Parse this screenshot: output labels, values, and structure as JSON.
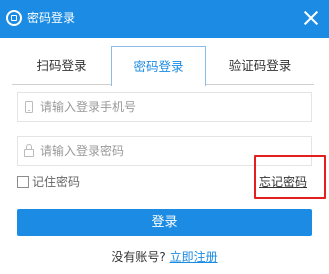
{
  "window": {
    "title": "密码登录",
    "close_icon": "close-icon",
    "app_icon": "app-logo-icon",
    "accent_color": "#1b8be3"
  },
  "tabs": [
    {
      "label": "扫码登录",
      "active": false
    },
    {
      "label": "密码登录",
      "active": true
    },
    {
      "label": "验证码登录",
      "active": false
    }
  ],
  "form": {
    "phone": {
      "placeholder": "请输入登录手机号",
      "value": "",
      "icon": "phone-icon"
    },
    "password": {
      "placeholder": "请输入登录密码",
      "value": "",
      "icon": "lock-icon"
    },
    "remember_label": "记住密码",
    "remember_checked": false,
    "forgot_label": "忘记密码",
    "forgot_highlight_color": "#e31f1f",
    "login_label": "登录"
  },
  "footer": {
    "prompt": "没有账号?",
    "register_label": "立即注册"
  }
}
